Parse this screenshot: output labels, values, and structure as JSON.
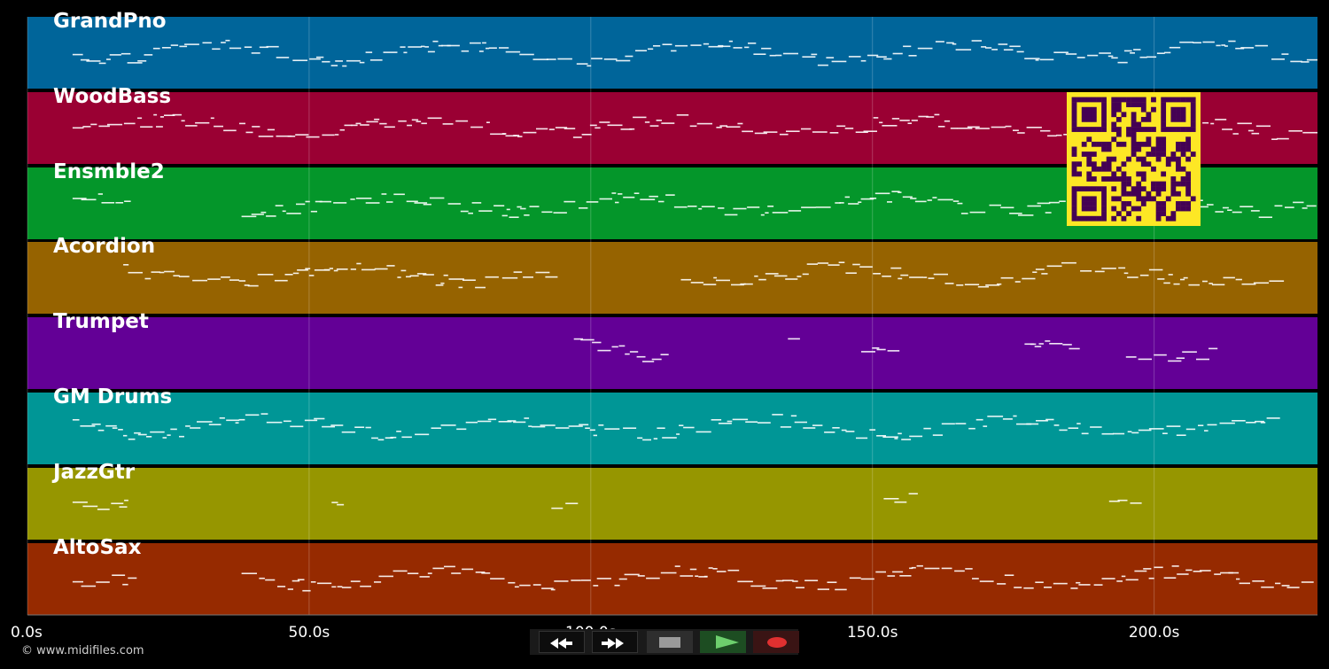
{
  "timeline": {
    "max_seconds": 229,
    "ticks": [
      "0.0s",
      "50.0s",
      "100.0s",
      "150.0s",
      "200.0s"
    ],
    "tick_values": [
      0,
      50,
      100,
      150,
      200
    ]
  },
  "tracks": [
    {
      "name": "GrandPno",
      "color": "#00659a"
    },
    {
      "name": "WoodBass",
      "color": "#9a0033"
    },
    {
      "name": "Ensmble2",
      "color": "#04962a"
    },
    {
      "name": "Acordion",
      "color": "#966300"
    },
    {
      "name": "Trumpet",
      "color": "#630096"
    },
    {
      "name": "GM Drums",
      "color": "#009696"
    },
    {
      "name": "JazzGtr",
      "color": "#969600"
    },
    {
      "name": "AltoSax",
      "color": "#962a00"
    }
  ],
  "copyright": "© www.midifiles.com",
  "controls": {
    "rewind_icon": "rewind-icon",
    "forward_icon": "fast-forward-icon",
    "stop_icon": "stop-icon",
    "play_icon": "play-icon",
    "record_icon": "record-icon"
  },
  "colors": {
    "qr_light": "#fde725",
    "qr_dark": "#440154",
    "grid": "#ffffff",
    "notes": "#ffffff"
  }
}
